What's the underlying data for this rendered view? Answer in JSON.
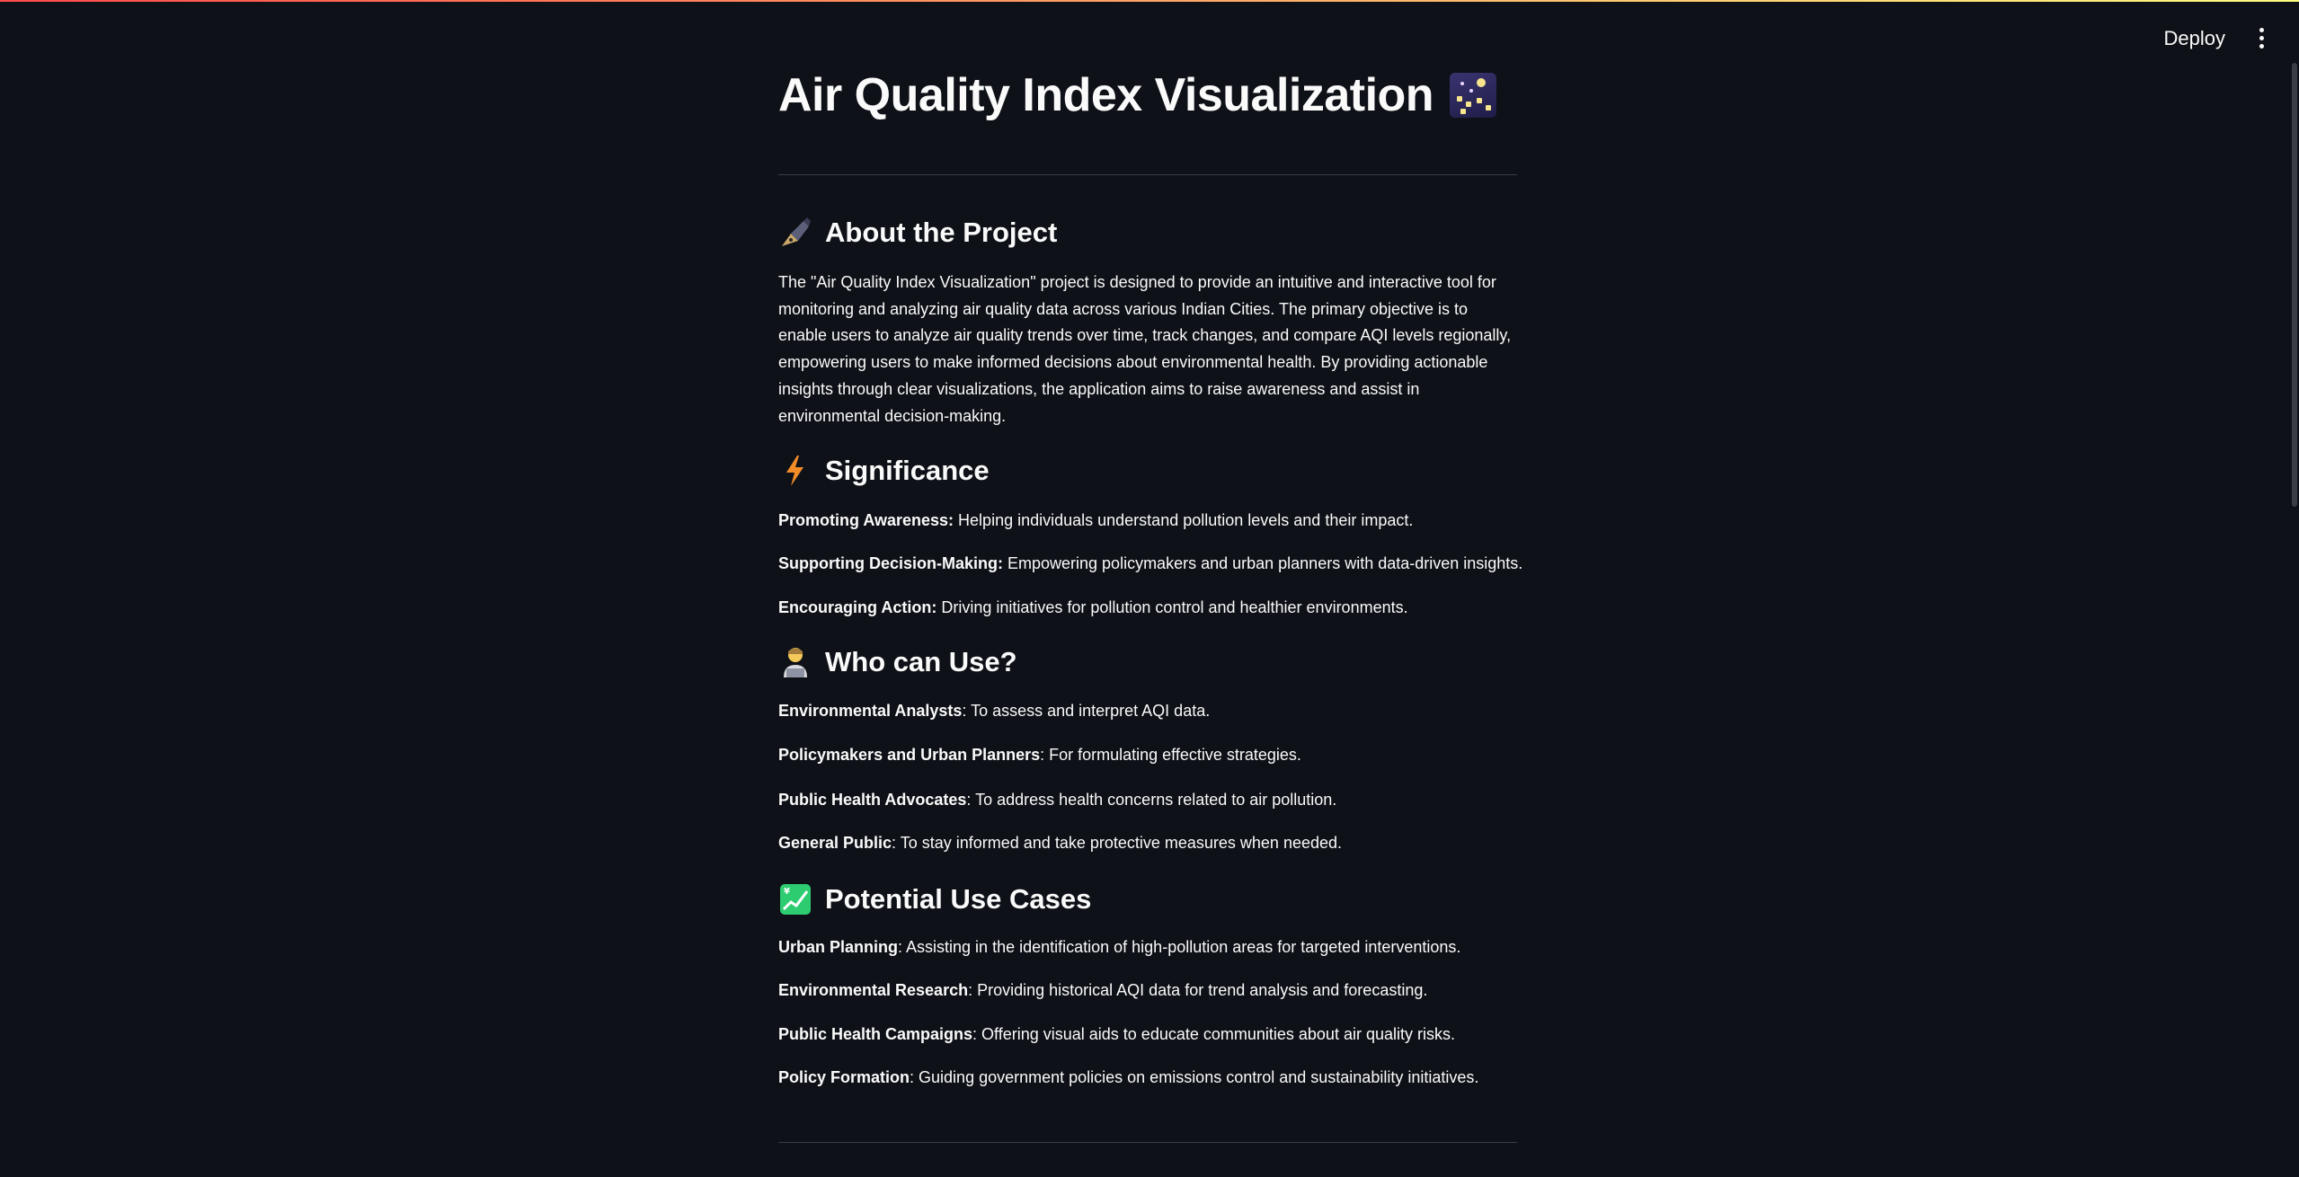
{
  "header": {
    "deploy_label": "Deploy"
  },
  "page": {
    "title": "Air Quality Index Visualization"
  },
  "about": {
    "heading": "About the Project",
    "icon": "fountain-pen-icon",
    "text": "The \"Air Quality Index Visualization\" project is designed to provide an intuitive and interactive tool for monitoring and analyzing air quality data across various Indian Cities. The primary objective is to enable users to analyze air quality trends over time, track changes, and compare AQI levels regionally, empowering users to make informed decisions about environmental health. By providing actionable insights through clear visualizations, the application aims to raise awareness and assist in environmental decision-making."
  },
  "significance": {
    "heading": "Significance",
    "icon": "lightning-icon",
    "items": [
      {
        "label": "Promoting Awareness:",
        "text": " Helping individuals understand pollution levels and their impact."
      },
      {
        "label": "Supporting Decision-Making:",
        "text": " Empowering policymakers and urban planners with data-driven insights."
      },
      {
        "label": "Encouraging Action:",
        "text": " Driving initiatives for pollution control and healthier environments."
      }
    ]
  },
  "who": {
    "heading": "Who can Use?",
    "icon": "technologist-icon",
    "items": [
      {
        "label": "Environmental Analysts",
        "text": ": To assess and interpret AQI data."
      },
      {
        "label": "Policymakers and Urban Planners",
        "text": ": For formulating effective strategies."
      },
      {
        "label": "Public Health Advocates",
        "text": ": To address health concerns related to air pollution."
      },
      {
        "label": "General Public",
        "text": ": To stay informed and take protective measures when needed."
      }
    ]
  },
  "usecases": {
    "heading": "Potential Use Cases",
    "icon": "chart-increasing-yen-icon",
    "items": [
      {
        "label": "Urban Planning",
        "text": ": Assisting in the identification of high-pollution areas for targeted interventions."
      },
      {
        "label": "Environmental Research",
        "text": ": Providing historical AQI data for trend analysis and forecasting."
      },
      {
        "label": "Public Health Campaigns",
        "text": ": Offering visual aids to educate communities about air quality risks."
      },
      {
        "label": "Policy Formation",
        "text": ": Guiding government policies on emissions control and sustainability initiatives."
      }
    ]
  }
}
